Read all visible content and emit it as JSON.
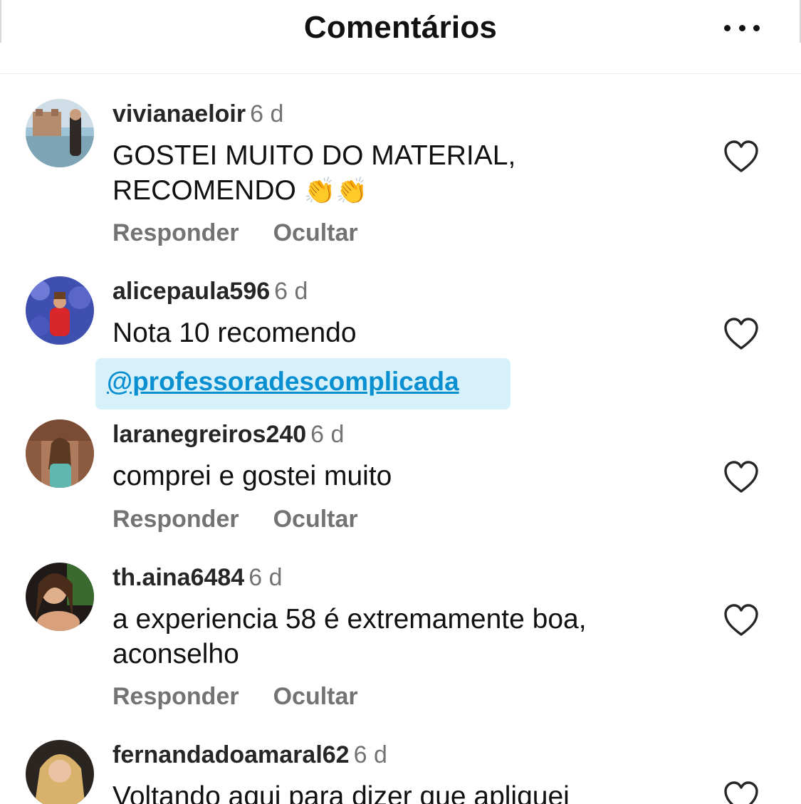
{
  "header": {
    "title": "Comentários",
    "more_icon": "more-horizontal-icon"
  },
  "comments": [
    {
      "username": "vivianaeloir",
      "time": "6 d",
      "text_lines": [
        "GOSTEI MUITO DO MATERIAL,",
        "RECOMENDO"
      ],
      "emoji": "👏👏",
      "reply": "Responder",
      "hide": "Ocultar"
    },
    {
      "username": "alicepaula596",
      "time": "6 d",
      "text_lines": [
        "Nota 10 recomendo"
      ],
      "mention": "@professoradescomplicada"
    },
    {
      "username": "laranegreiros240",
      "time": "6 d",
      "text_lines": [
        "comprei e gostei muito"
      ],
      "reply": "Responder",
      "hide": "Ocultar"
    },
    {
      "username": "th.aina6484",
      "time": "6 d",
      "text_lines": [
        "a experiencia 58 é extremamente boa,",
        "aconselho"
      ],
      "reply": "Responder",
      "hide": "Ocultar"
    },
    {
      "username": "fernandadoamaral62",
      "time": "6 d",
      "text_lines": [
        "Voltando aqui para dizer que apliquei"
      ]
    }
  ],
  "colors": {
    "username": "#262626",
    "secondary": "#737373",
    "mention_bg": "#d7f1fb",
    "mention_text": "#0a8fd1"
  }
}
